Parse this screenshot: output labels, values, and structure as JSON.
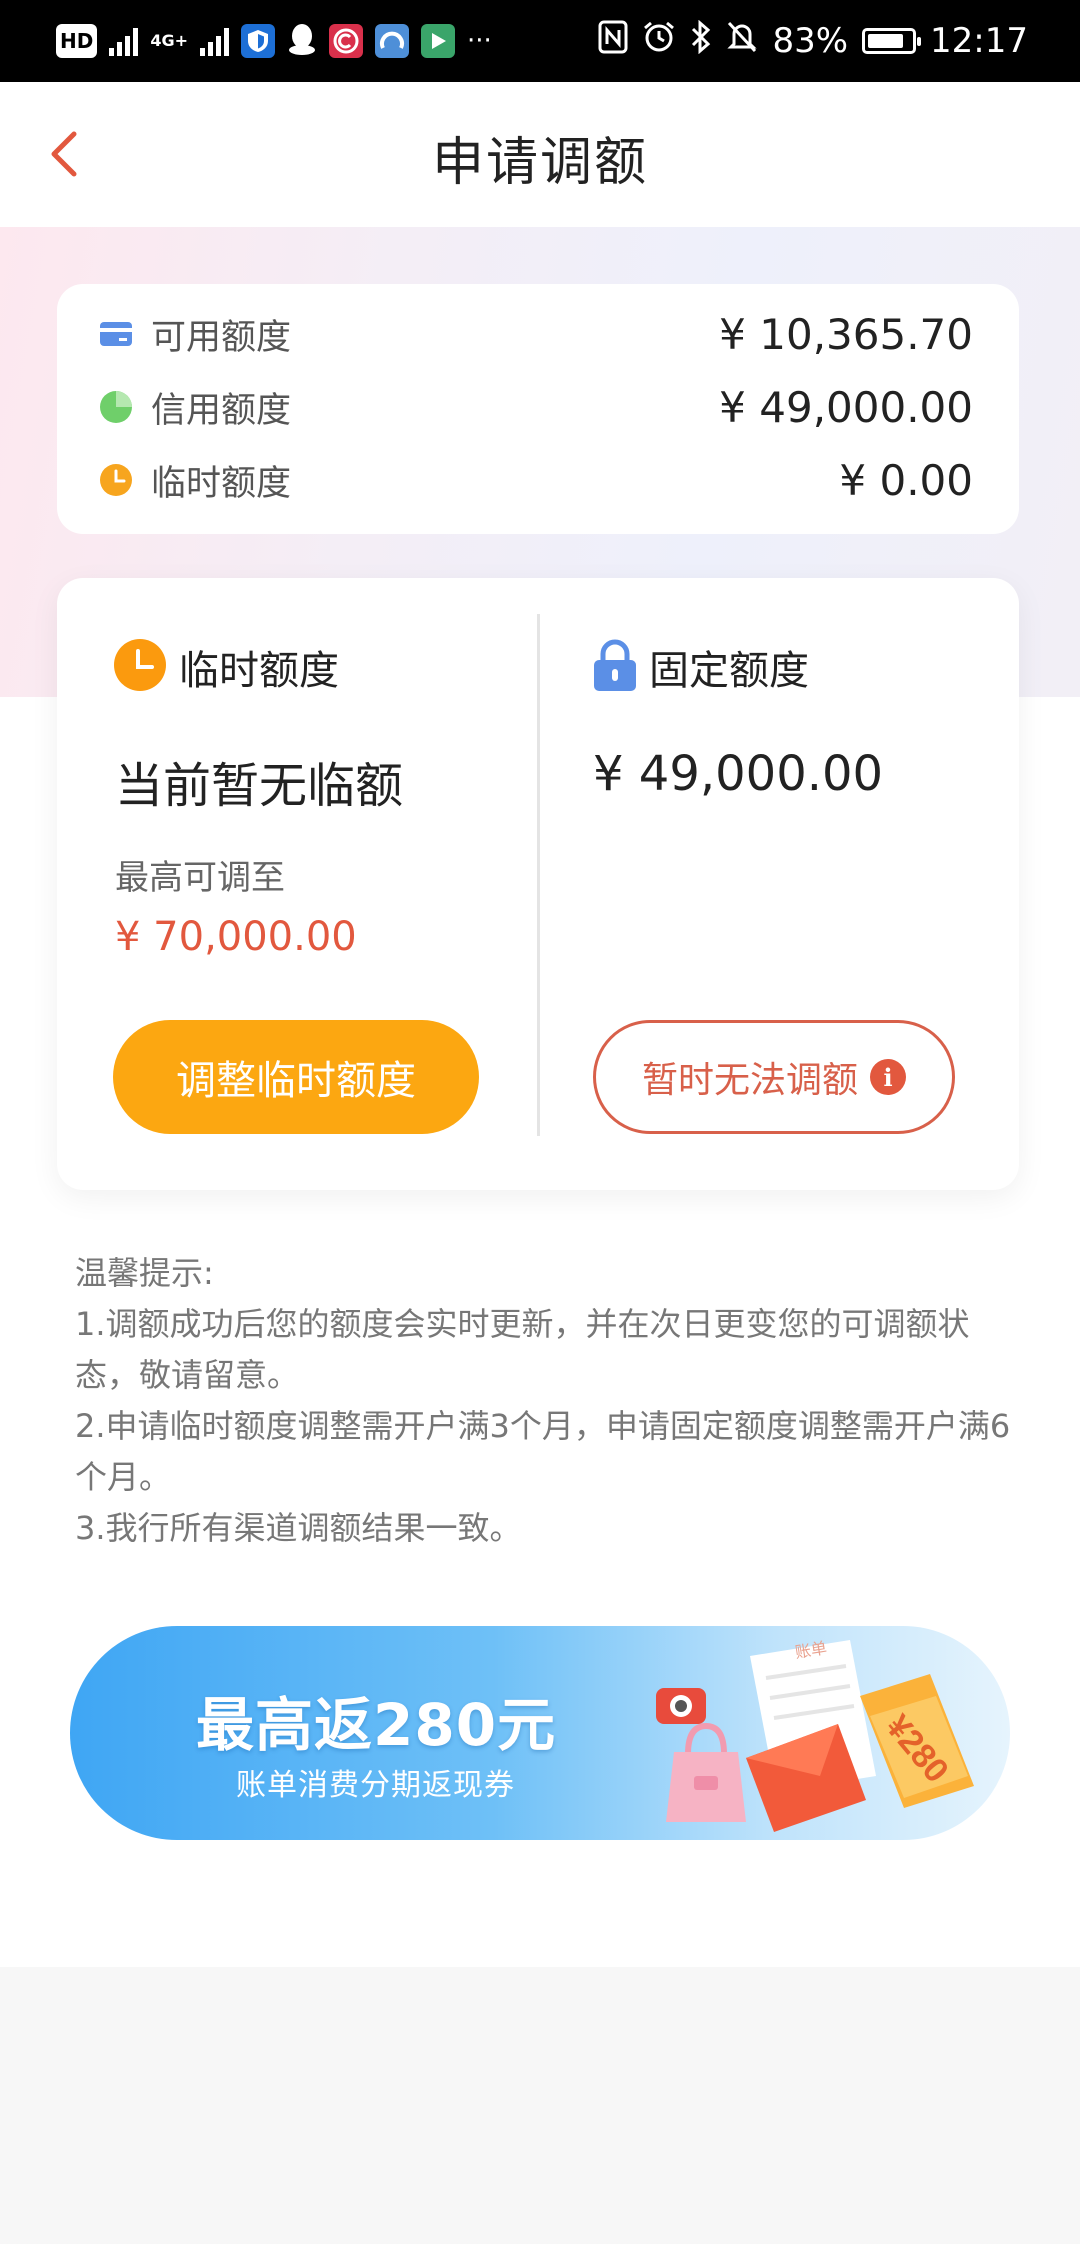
{
  "status_bar": {
    "hd": "HD",
    "network": "4G+",
    "battery_percent": "83%",
    "time": "12:17",
    "more": "···",
    "battery_level": 0.83
  },
  "nav": {
    "title": "申请调额",
    "back_icon": "chevron-left-icon"
  },
  "summary": {
    "rows": [
      {
        "label": "可用额度",
        "value": "¥ 10,365.70",
        "icon": "card-icon",
        "color": "#5b8fe6"
      },
      {
        "label": "信用额度",
        "value": "¥ 49,000.00",
        "icon": "pie-icon",
        "color": "#6fcf6a"
      },
      {
        "label": "临时额度",
        "value": "¥ 0.00",
        "icon": "clock-icon",
        "color": "#f7a51e"
      }
    ]
  },
  "temporary": {
    "title": "临时额度",
    "status": "当前暂无临额",
    "max_label": "最高可调至",
    "max_value": "¥ 70,000.00",
    "button": "调整临时额度"
  },
  "fixed": {
    "title": "固定额度",
    "amount": "¥ 49,000.00",
    "button": "暂时无法调额",
    "info_glyph": "i"
  },
  "tips": {
    "title": "温馨提示:",
    "lines": [
      "1.调额成功后您的额度会实时更新，并在次日更变您的可调额状态，敬请留意。",
      "2.申请临时额度调整需开户满3个月，申请固定额度调整需开户满6个月。",
      "3.我行所有渠道调额结果一致。"
    ]
  },
  "banner": {
    "title": "最高返280元",
    "subtitle": "账单消费分期返现券",
    "doc_text": "账单",
    "coupon_text": "¥280"
  },
  "colors": {
    "accent_orange": "#fca711",
    "accent_red": "#e2583e",
    "primary_text": "#222222"
  }
}
